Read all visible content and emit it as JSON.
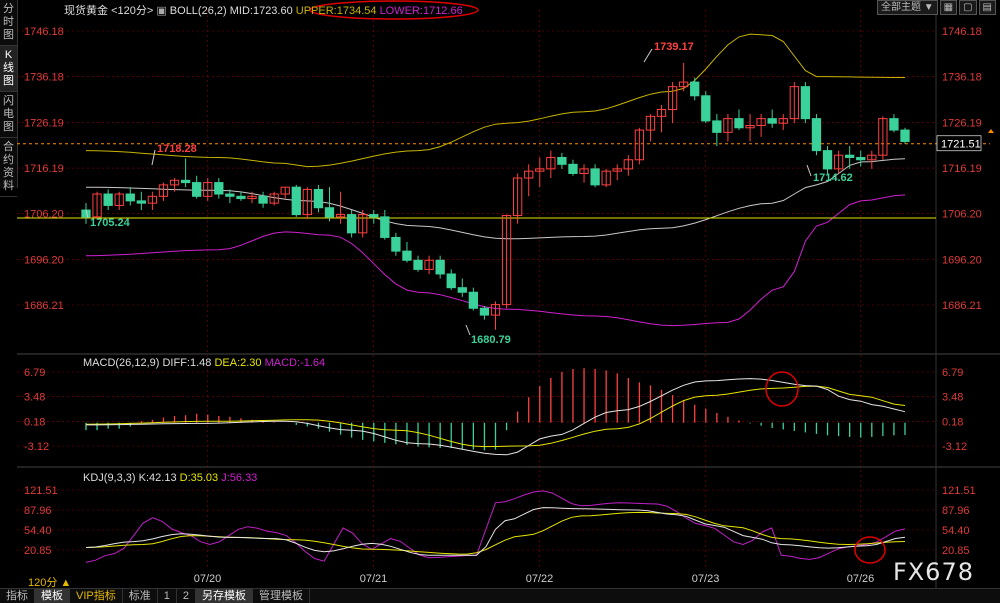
{
  "left_tabs": [
    "分时图",
    "K线图",
    "闪电图",
    "合约资料"
  ],
  "boll": {
    "symbol": "现货黄金",
    "period": "<120分>",
    "name": "BOLL(26,2)",
    "mid": "MID:1723.60",
    "upper": "UPPER:1734.54",
    "lower": "LOWER:1712.66"
  },
  "macd": {
    "name": "MACD(26,12,9)",
    "diff": "DIFF:1.48",
    "dea": "DEA:2.30",
    "macd": "MACD:-1.64"
  },
  "kdj": {
    "name": "KDJ(9,3,3)",
    "k": "K:42.13",
    "d": "D:35.03",
    "j": "J:56.33"
  },
  "top_right": {
    "theme": "全部主题"
  },
  "price_axis": [
    "1746.18",
    "1736.18",
    "1726.19",
    "1716.19",
    "1706.20",
    "1696.20",
    "1686.21"
  ],
  "macd_axis": [
    "6.79",
    "3.48",
    "0.18",
    "-3.12"
  ],
  "kdj_axis": [
    "121.51",
    "87.96",
    "54.40",
    "20.85"
  ],
  "current_price": "1721.51",
  "annotations": {
    "high": "1739.17",
    "low": "1680.79",
    "a1": "1718.28",
    "a2": "1705.24",
    "a3": "1714.62"
  },
  "date_labels": [
    "07/20",
    "07/21",
    "07/22",
    "07/23",
    "07/26"
  ],
  "period_btn": "120分",
  "bottom_tabs": [
    "指标",
    "模板",
    "VIP指标",
    "标准",
    "1",
    "2",
    "另存模板",
    "管理模板"
  ],
  "watermark": "FX678",
  "colors": {
    "up": "#ff4040",
    "down": "#3ad29a",
    "mid": "#c8c8c8",
    "upper": "#c8b400",
    "lower": "#d020d0",
    "yellow": "#e6e600",
    "grid": "#8b0000"
  },
  "chart_data": [
    {
      "type": "candlestick",
      "title": "现货黄金 BOLL(26,2)",
      "ylim": [
        1676,
        1750
      ],
      "candles": [
        [
          1707,
          1708.5,
          1704,
          1705.5
        ],
        [
          1705.5,
          1711,
          1705,
          1710.5
        ],
        [
          1710.5,
          1711.5,
          1707,
          1708
        ],
        [
          1708,
          1711,
          1707,
          1710.5
        ],
        [
          1710.5,
          1712,
          1708,
          1709
        ],
        [
          1709,
          1711,
          1707,
          1708.5
        ],
        [
          1708.5,
          1711,
          1707,
          1710
        ],
        [
          1710,
          1713,
          1709,
          1712.5
        ],
        [
          1712.5,
          1714,
          1711,
          1713.5
        ],
        [
          1713.5,
          1718.3,
          1712,
          1713
        ],
        [
          1713,
          1714.5,
          1709.5,
          1710
        ],
        [
          1710,
          1714,
          1709,
          1713
        ],
        [
          1713,
          1714,
          1709.5,
          1710.5
        ],
        [
          1710.5,
          1711.5,
          1708.5,
          1710
        ],
        [
          1710,
          1711,
          1709,
          1709.5
        ],
        [
          1709.5,
          1711,
          1708.5,
          1710
        ],
        [
          1710,
          1711,
          1707.5,
          1708.5
        ],
        [
          1708.5,
          1711,
          1708,
          1710.5
        ],
        [
          1710.5,
          1712,
          1709.5,
          1712
        ],
        [
          1712,
          1712.5,
          1705.5,
          1706
        ],
        [
          1706,
          1712,
          1705,
          1711.5
        ],
        [
          1711.5,
          1712.5,
          1706.5,
          1707.5
        ],
        [
          1707.5,
          1712,
          1704.5,
          1705.5
        ],
        [
          1705.5,
          1711,
          1704,
          1706
        ],
        [
          1706,
          1707,
          1701,
          1702
        ],
        [
          1702,
          1707,
          1701,
          1706
        ],
        [
          1706,
          1707,
          1704,
          1705.5
        ],
        [
          1705.5,
          1707,
          1700.5,
          1701
        ],
        [
          1701,
          1702,
          1697,
          1698
        ],
        [
          1698,
          1700,
          1695.5,
          1696
        ],
        [
          1696,
          1697,
          1693.5,
          1694
        ],
        [
          1694,
          1697,
          1693,
          1696
        ],
        [
          1696,
          1697,
          1692,
          1693
        ],
        [
          1693,
          1694,
          1689.5,
          1690
        ],
        [
          1690,
          1692,
          1688,
          1689
        ],
        [
          1689,
          1690,
          1685,
          1685.5
        ],
        [
          1685.5,
          1686,
          1683,
          1684
        ],
        [
          1684,
          1687,
          1680.8,
          1686.3
        ],
        [
          1686.3,
          1706,
          1685.5,
          1705.8
        ],
        [
          1705.8,
          1715,
          1704,
          1714
        ],
        [
          1714,
          1717,
          1710,
          1715.5
        ],
        [
          1715.5,
          1718.5,
          1712,
          1716
        ],
        [
          1716,
          1720,
          1714,
          1718.5
        ],
        [
          1718.5,
          1719.5,
          1716,
          1717
        ],
        [
          1717,
          1718,
          1714.5,
          1715
        ],
        [
          1715,
          1717,
          1713,
          1716
        ],
        [
          1716,
          1717,
          1712,
          1712.5
        ],
        [
          1712.5,
          1716,
          1712,
          1715.5
        ],
        [
          1715.5,
          1717,
          1713.5,
          1716
        ],
        [
          1716,
          1719,
          1714.5,
          1718
        ],
        [
          1718,
          1725,
          1717,
          1724.5
        ],
        [
          1724.5,
          1728,
          1722,
          1727.5
        ],
        [
          1727.5,
          1730,
          1724,
          1729
        ],
        [
          1729,
          1735,
          1726,
          1734
        ],
        [
          1734,
          1739.2,
          1733,
          1735
        ],
        [
          1735,
          1736,
          1731,
          1732
        ],
        [
          1732,
          1733,
          1726,
          1726.5
        ],
        [
          1726.5,
          1728,
          1721,
          1724
        ],
        [
          1724,
          1728,
          1722,
          1727
        ],
        [
          1727,
          1729,
          1724.5,
          1725
        ],
        [
          1725,
          1728,
          1722,
          1725.5
        ],
        [
          1725.5,
          1728,
          1723,
          1727
        ],
        [
          1727,
          1729,
          1725,
          1726
        ],
        [
          1726,
          1728,
          1724.5,
          1727
        ],
        [
          1727,
          1735,
          1726,
          1734
        ],
        [
          1734,
          1735,
          1726,
          1727
        ],
        [
          1727,
          1728,
          1719,
          1720
        ],
        [
          1720,
          1721,
          1714.6,
          1716
        ],
        [
          1716,
          1720,
          1715,
          1719
        ],
        [
          1719,
          1721,
          1716,
          1718.5
        ],
        [
          1718.5,
          1720,
          1716.5,
          1718
        ],
        [
          1718,
          1720,
          1716,
          1719
        ],
        [
          1719,
          1727.5,
          1718,
          1727
        ],
        [
          1727,
          1728,
          1724,
          1724.5
        ],
        [
          1724.5,
          1725,
          1721.5,
          1722
        ]
      ],
      "series": [
        {
          "name": "MID",
          "values": [
            1722,
            1723,
            1723.6
          ]
        },
        {
          "name": "UPPER",
          "values": [
            1734,
            1734.3,
            1734.54
          ]
        },
        {
          "name": "LOWER",
          "values": [
            1710,
            1711.5,
            1712.66
          ]
        }
      ]
    },
    {
      "type": "macd",
      "title": "MACD(26,12,9)",
      "ylim": [
        -5.5,
        8.5
      ],
      "histogram": [
        -1.0,
        -1.0,
        -0.8,
        -0.8,
        -0.5,
        0.2,
        0.4,
        0.7,
        0.9,
        1.0,
        1.2,
        1.1,
        0.9,
        0.8,
        0.6,
        0.4,
        0.2,
        0.1,
        0,
        -0.3,
        -0.5,
        -0.8,
        -1.2,
        -1.6,
        -2.0,
        -2.3,
        -2.5,
        -2.7,
        -2.9,
        -3.0,
        -3.2,
        -3.3,
        -3.4,
        -3.4,
        -3.5,
        -3.6,
        -3.7,
        -3.6,
        -1.0,
        1.5,
        3.4,
        4.9,
        6.0,
        6.8,
        7.2,
        7.3,
        7.2,
        7.0,
        6.6,
        6.0,
        5.4,
        5.0,
        4.4,
        3.7,
        3.0,
        2.4,
        1.9,
        1.3,
        0.8,
        0.3,
        -0.1,
        -0.4,
        -0.7,
        -0.9,
        -1.1,
        -1.3,
        -1.5,
        -1.7,
        -1.8,
        -1.9,
        -2.0,
        -1.9,
        -1.8,
        -1.7,
        -1.64
      ],
      "series": [
        {
          "name": "DIFF",
          "values": [
            1.48
          ]
        },
        {
          "name": "DEA",
          "values": [
            2.3
          ]
        }
      ]
    },
    {
      "type": "kdj",
      "title": "KDJ(9,3,3)",
      "ylim": [
        0,
        125
      ],
      "series": [
        {
          "name": "K",
          "values": [
            42.13
          ]
        },
        {
          "name": "D",
          "values": [
            35.03
          ]
        },
        {
          "name": "J",
          "values": [
            56.33
          ]
        }
      ]
    }
  ]
}
